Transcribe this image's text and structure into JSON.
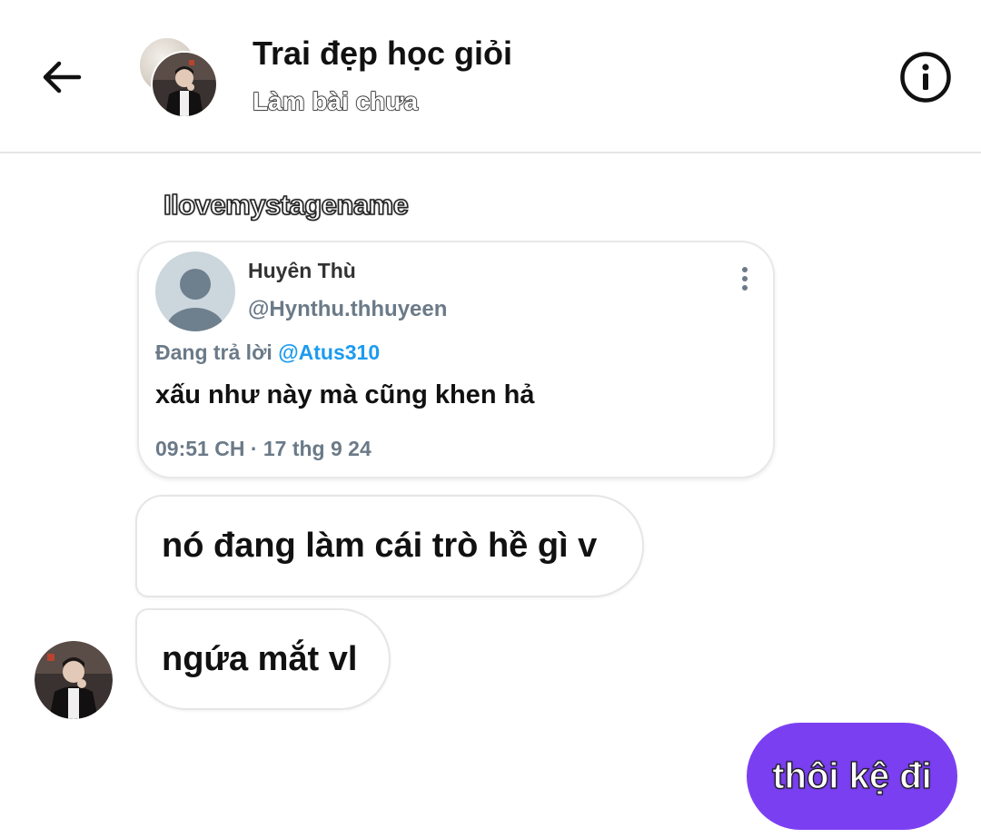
{
  "header": {
    "title": "Trai đẹp học giỏi",
    "subtitle": "Làm bài chưa"
  },
  "thread": {
    "sender_name": "Ilovemystagename",
    "shared_tweet": {
      "author_name": "Huyên Thù",
      "author_handle": "@Hynthu.thhuyeen",
      "reply_prefix": "Đang trả lời",
      "reply_mention": "@Atus310",
      "text": "xấu như này mà cũng khen hả",
      "timestamp": "09:51 CH · 17 thg 9 24"
    },
    "messages": [
      {
        "direction": "incoming",
        "text": "nó đang làm cái trò hề gì v"
      },
      {
        "direction": "incoming",
        "text": "ngứa mắt vl"
      },
      {
        "direction": "outgoing",
        "text": "thôi kệ đi"
      }
    ]
  },
  "colors": {
    "outgoing_bubble": "#7b3ff2",
    "mention": "#1d9bf0",
    "secondary_text": "#6b7a88"
  },
  "icons": {
    "back": "arrow-left-icon",
    "info": "info-circle-icon",
    "more": "more-vertical-icon"
  }
}
